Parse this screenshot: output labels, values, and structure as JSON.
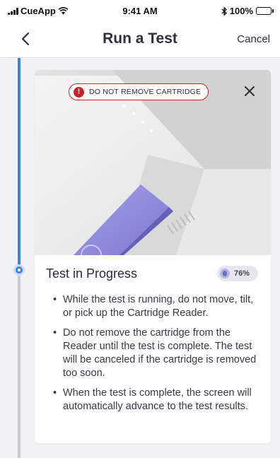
{
  "status_bar": {
    "carrier": "CueApp",
    "time": "9:41 AM",
    "battery": "100%"
  },
  "nav": {
    "title": "Run a Test",
    "cancel_label": "Cancel"
  },
  "timeline": {
    "progress_fraction": 0.53,
    "active_color": "#3f7fe8",
    "inactive_color": "#c9c9d0"
  },
  "card": {
    "warning_label": "DO NOT REMOVE CARTRIDGE",
    "warning_color": "#c8202e",
    "title": "Test in Progress",
    "progress_percent": "76%",
    "instructions": [
      "While the test is running, do not move, tilt, or pick up the Cartridge Reader.",
      "Do not remove the cartridge from the Reader until the test is complete. The test will be canceled if the cartridge is removed too soon.",
      "When the test is complete, the screen will automatically advance to the test results."
    ]
  },
  "icons": {
    "back": "chevron-left-icon",
    "close": "close-icon",
    "warning": "exclamation-icon",
    "progress": "cartridge-icon"
  },
  "colors": {
    "accent_purple": "#8a86d8",
    "background": "#f2f2f4"
  }
}
